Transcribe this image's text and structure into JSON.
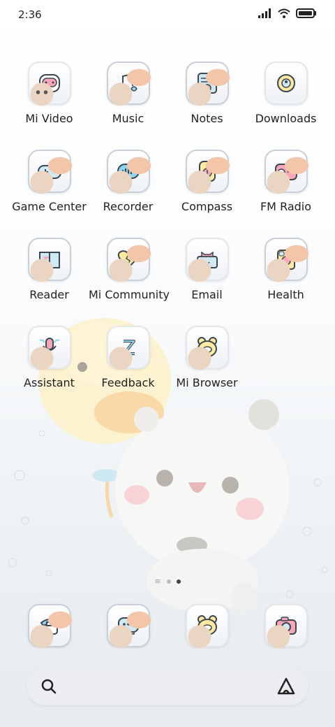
{
  "status_bar": {
    "time": "2:36"
  },
  "apps": [
    {
      "label": "Mi Video",
      "icon": "robot-tv-icon"
    },
    {
      "label": "Music",
      "icon": "music-note-icon"
    },
    {
      "label": "Notes",
      "icon": "notebook-cat-icon"
    },
    {
      "label": "Downloads",
      "icon": "download-flower-icon"
    },
    {
      "label": "Game Center",
      "icon": "gamepad-icon"
    },
    {
      "label": "Recorder",
      "icon": "soundwave-icon"
    },
    {
      "label": "Compass",
      "icon": "compass-box-icon"
    },
    {
      "label": "FM Radio",
      "icon": "radio-icon"
    },
    {
      "label": "Reader",
      "icon": "book-heart-icon"
    },
    {
      "label": "Mi Community",
      "icon": "broken-heart-icon"
    },
    {
      "label": "Email",
      "icon": "envelope-cat-icon"
    },
    {
      "label": "Health",
      "icon": "health-cat-icon"
    },
    {
      "label": "Assistant",
      "icon": "microphone-wings-icon"
    },
    {
      "label": "Feedback",
      "icon": "feedback-z-icon"
    },
    {
      "label": "Mi Browser",
      "icon": "browser-bear-icon"
    }
  ],
  "page_indicator": {
    "pages": 3,
    "active": 2
  },
  "dock": [
    {
      "icon": "phone-icon"
    },
    {
      "icon": "messages-icon"
    },
    {
      "icon": "browser-bear-icon"
    },
    {
      "icon": "camera-icon"
    }
  ],
  "search": {
    "icon": "search-icon",
    "assistant_icon": "assistant-triangle-icon"
  },
  "colors": {
    "accent_blue": "#8fd3ee",
    "accent_pink": "#f7a6b8",
    "accent_yellow": "#fde9a0",
    "outline": "#3b4650"
  }
}
